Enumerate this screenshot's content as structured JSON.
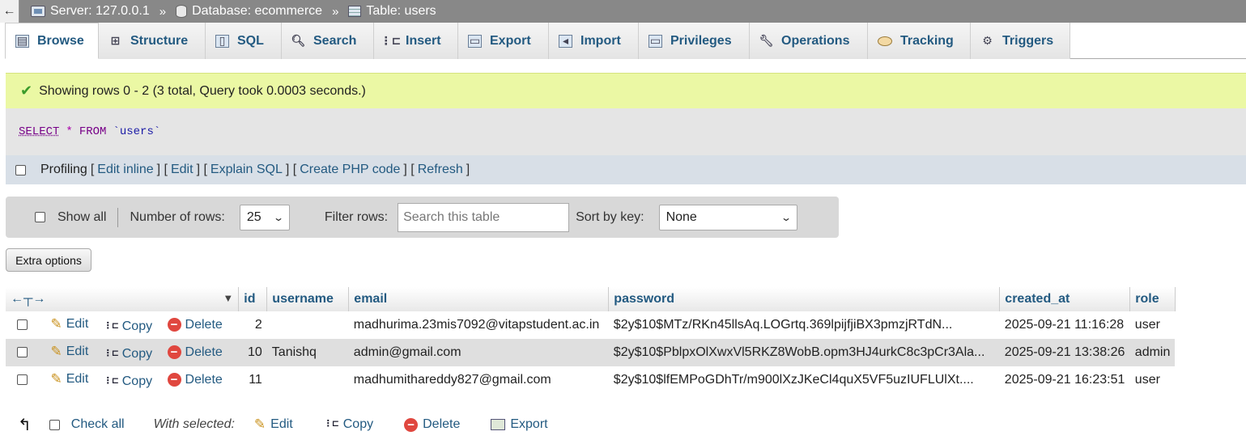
{
  "breadcrumb": {
    "back": "←",
    "server": "Server: 127.0.0.1",
    "database": "Database: ecommerce",
    "table": "Table: users",
    "separator": "»"
  },
  "tabs": [
    {
      "label": "Browse",
      "icon": "browse-icon",
      "active": true
    },
    {
      "label": "Structure",
      "icon": "structure-icon"
    },
    {
      "label": "SQL",
      "icon": "sql-icon"
    },
    {
      "label": "Search",
      "icon": "search-icon"
    },
    {
      "label": "Insert",
      "icon": "insert-icon"
    },
    {
      "label": "Export",
      "icon": "export-icon"
    },
    {
      "label": "Import",
      "icon": "import-icon"
    },
    {
      "label": "Privileges",
      "icon": "privileges-icon"
    },
    {
      "label": "Operations",
      "icon": "wrench-icon"
    },
    {
      "label": "Tracking",
      "icon": "eye-icon"
    },
    {
      "label": "Triggers",
      "icon": "triggers-icon"
    }
  ],
  "message": {
    "text": "Showing rows 0 - 2 (3 total, Query took 0.0003 seconds.)",
    "color": "#ebf8a4"
  },
  "sql": {
    "select": "SELECT",
    "star": "*",
    "from": "FROM",
    "table": "`users`"
  },
  "profiling": {
    "label": "Profiling",
    "links": [
      "Edit inline",
      "Edit",
      "Explain SQL",
      "Create PHP code",
      "Refresh"
    ]
  },
  "nav": {
    "show_all": "Show all",
    "rows_label": "Number of rows:",
    "rows_value": "25",
    "filter_label": "Filter rows:",
    "filter_placeholder": "Search this table",
    "sort_label": "Sort by key:",
    "sort_value": "None"
  },
  "extra_options": "Extra options",
  "table": {
    "columns": [
      "id",
      "username",
      "email",
      "password",
      "created_at",
      "role"
    ],
    "actions": {
      "edit": "Edit",
      "copy": "Copy",
      "delete": "Delete"
    },
    "rows": [
      {
        "id": "2",
        "username": "",
        "email": "madhurima.23mis7092@vitapstudent.ac.in",
        "password": "$2y$10$MTz/RKn45llsAq.LOGrtq.369lpijfjiBX3pmzjRTdN...",
        "created_at": "2025-09-21 11:16:28",
        "role": "user"
      },
      {
        "id": "10",
        "username": "Tanishq",
        "email": "admin@gmail.com",
        "password": "$2y$10$PblpxOlXwxVl5RKZ8WobB.opm3HJ4urkC8c3pCr3Ala...",
        "created_at": "2025-09-21 13:38:26",
        "role": "admin"
      },
      {
        "id": "11",
        "username": "",
        "email": "madhumithareddy827@gmail.com",
        "password": "$2y$10$lfEMPoGDhTr/m900lXzJKeCl4quX5VF5uzIUFLUlXt....",
        "created_at": "2025-09-21 16:23:51",
        "role": "user"
      }
    ]
  },
  "bottom": {
    "check_all": "Check all",
    "with_selected": "With selected:",
    "edit": "Edit",
    "copy": "Copy",
    "delete": "Delete",
    "export": "Export"
  }
}
